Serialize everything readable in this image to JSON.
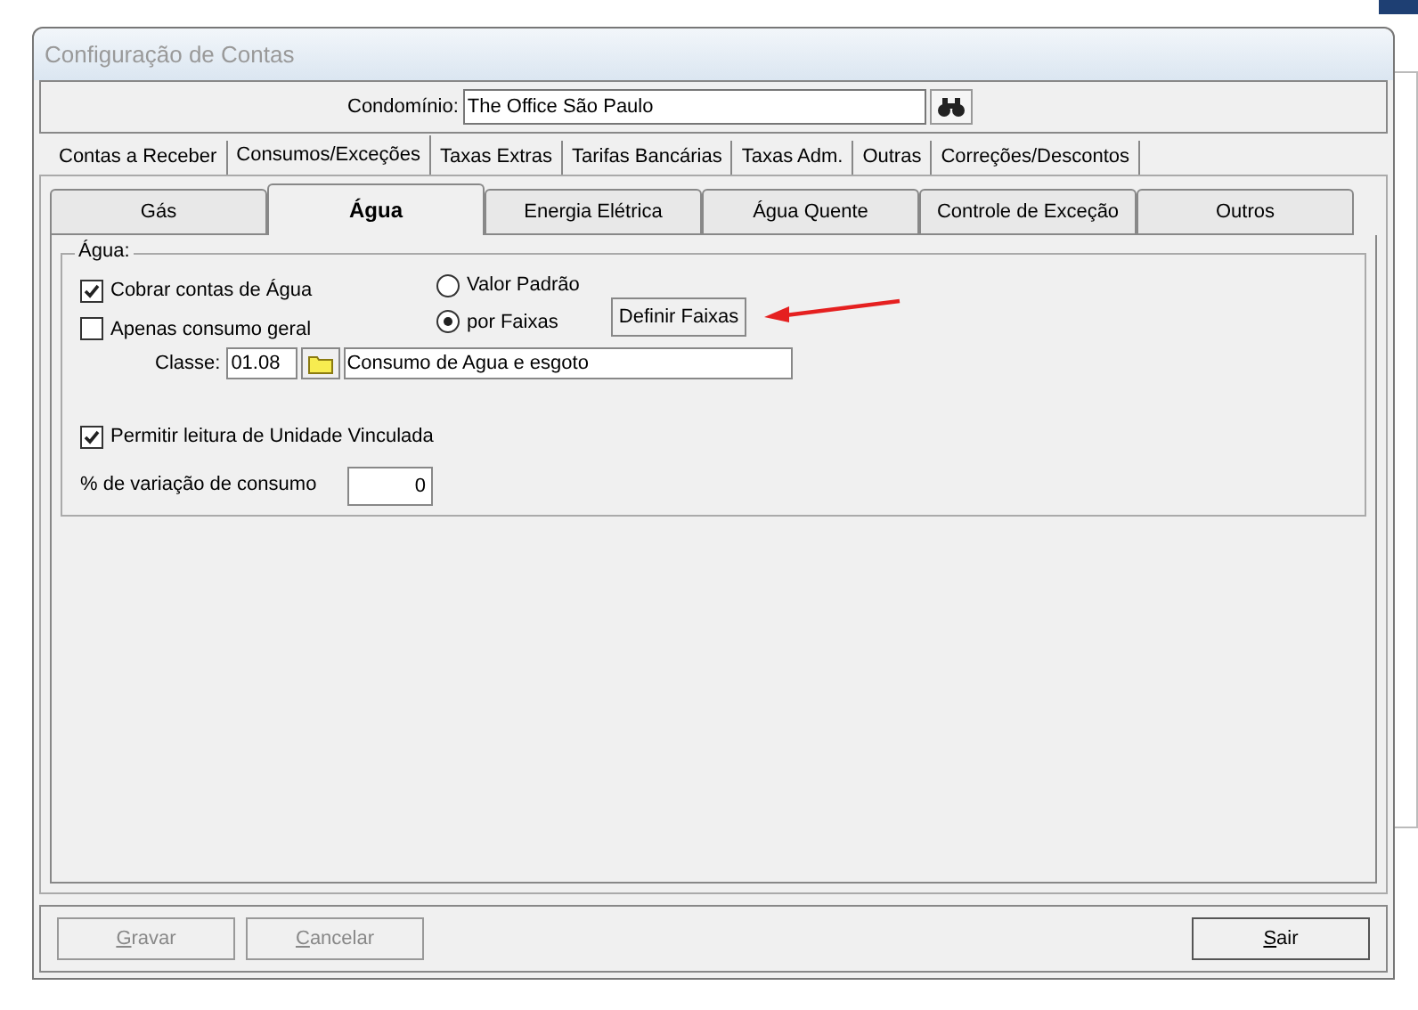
{
  "window": {
    "title": "Configuração de Contas"
  },
  "condominio": {
    "label": "Condomínio:",
    "value": "The Office São Paulo"
  },
  "tabs": [
    {
      "label": "Contas a Receber",
      "selected": false
    },
    {
      "label": "Consumos/Exceções",
      "selected": true
    },
    {
      "label": "Taxas Extras",
      "selected": false
    },
    {
      "label": "Tarifas Bancárias",
      "selected": false
    },
    {
      "label": "Taxas Adm.",
      "selected": false
    },
    {
      "label": "Outras",
      "selected": false
    },
    {
      "label": "Correções/Descontos",
      "selected": false
    }
  ],
  "subtabs": [
    {
      "label": "Gás",
      "selected": false
    },
    {
      "label": "Água",
      "selected": true
    },
    {
      "label": "Energia Elétrica",
      "selected": false
    },
    {
      "label": "Água Quente",
      "selected": false
    },
    {
      "label": "Controle de Exceção",
      "selected": false
    },
    {
      "label": "Outros",
      "selected": false
    }
  ],
  "group": {
    "title": "Água:",
    "checkboxes": [
      {
        "label": "Cobrar contas de Água",
        "checked": true
      },
      {
        "label": "Apenas consumo geral",
        "checked": false
      }
    ],
    "radios": [
      {
        "label": "Valor Padrão",
        "selected": false
      },
      {
        "label": "por Faixas",
        "selected": true
      }
    ],
    "define_button": "Definir Faixas",
    "classe": {
      "label": "Classe:",
      "code": "01.08",
      "description": "Consumo de Agua e esgoto"
    },
    "vinculada": {
      "label": "Permitir leitura de Unidade Vinculada",
      "checked": true
    },
    "variacao": {
      "label": "% de variação de consumo",
      "value": "0"
    }
  },
  "buttons": [
    {
      "label": "Gravar",
      "disabled": true
    },
    {
      "label": "Cancelar",
      "disabled": true
    },
    {
      "label": "Sair",
      "disabled": false
    }
  ]
}
